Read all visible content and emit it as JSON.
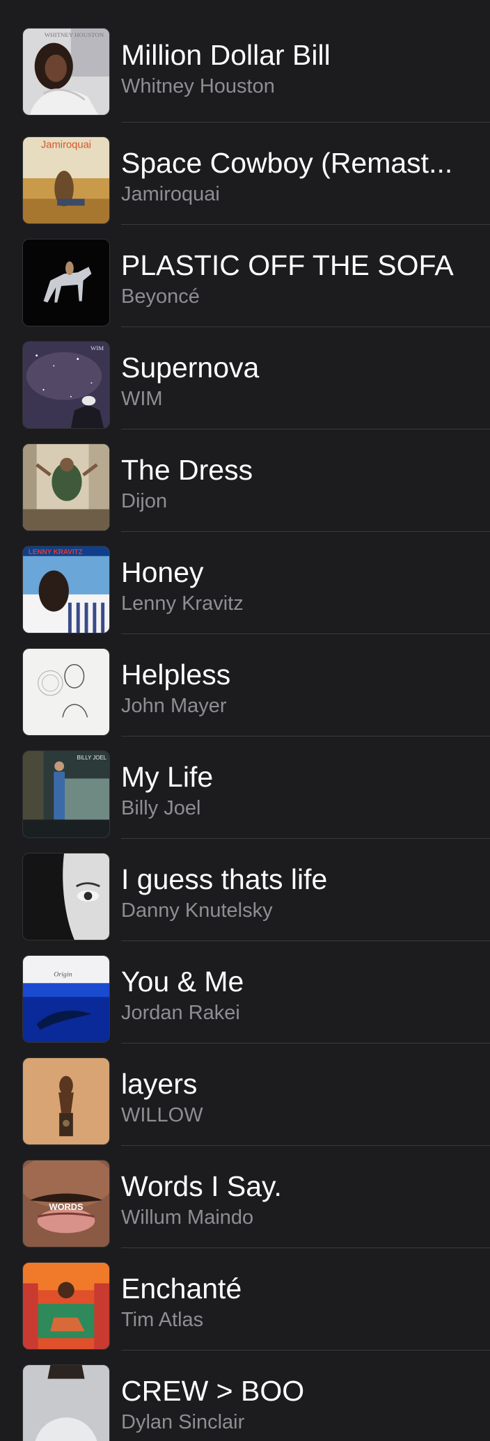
{
  "songs": [
    {
      "title": "Million Dollar Bill",
      "artist": "Whitney Houston",
      "art_icon": "album-art-whitney-houston",
      "art_text": "WHITNEY HOUSTON"
    },
    {
      "title": "Space Cowboy (Remast...",
      "artist": "Jamiroquai",
      "art_icon": "album-art-jamiroquai",
      "art_text": "Jamiroquai"
    },
    {
      "title": "PLASTIC OFF THE SOFA",
      "artist": "Beyoncé",
      "art_icon": "album-art-beyonce",
      "art_text": ""
    },
    {
      "title": "Supernova",
      "artist": "WIM",
      "art_icon": "album-art-wim",
      "art_text": "WIM"
    },
    {
      "title": "The Dress",
      "artist": "Dijon",
      "art_icon": "album-art-dijon",
      "art_text": ""
    },
    {
      "title": "Honey",
      "artist": "Lenny Kravitz",
      "art_icon": "album-art-lenny-kravitz",
      "art_text": "LENNY KRAVITZ"
    },
    {
      "title": "Helpless",
      "artist": "John Mayer",
      "art_icon": "album-art-john-mayer",
      "art_text": ""
    },
    {
      "title": "My Life",
      "artist": "Billy Joel",
      "art_icon": "album-art-billy-joel",
      "art_text": "BILLY JOEL"
    },
    {
      "title": "I guess thats life",
      "artist": "Danny Knutelsky",
      "art_icon": "album-art-danny-knutelsky",
      "art_text": ""
    },
    {
      "title": "You & Me",
      "artist": "Jordan Rakei",
      "art_icon": "album-art-jordan-rakei",
      "art_text": "Origin"
    },
    {
      "title": "layers",
      "artist": "WILLOW",
      "art_icon": "album-art-willow",
      "art_text": ""
    },
    {
      "title": "Words I Say.",
      "artist": "Willum Maindo",
      "art_icon": "album-art-willum-maindo",
      "art_text": "WORDS"
    },
    {
      "title": "Enchanté",
      "artist": "Tim Atlas",
      "art_icon": "album-art-tim-atlas",
      "art_text": ""
    },
    {
      "title": "CREW > BOO",
      "artist": "Dylan Sinclair",
      "art_icon": "album-art-dylan-sinclair",
      "art_text": ""
    }
  ],
  "colors": {
    "background": "#1c1c1e",
    "title": "#ffffff",
    "subtitle": "#8e8e93",
    "separator": "#3a3a3c"
  }
}
